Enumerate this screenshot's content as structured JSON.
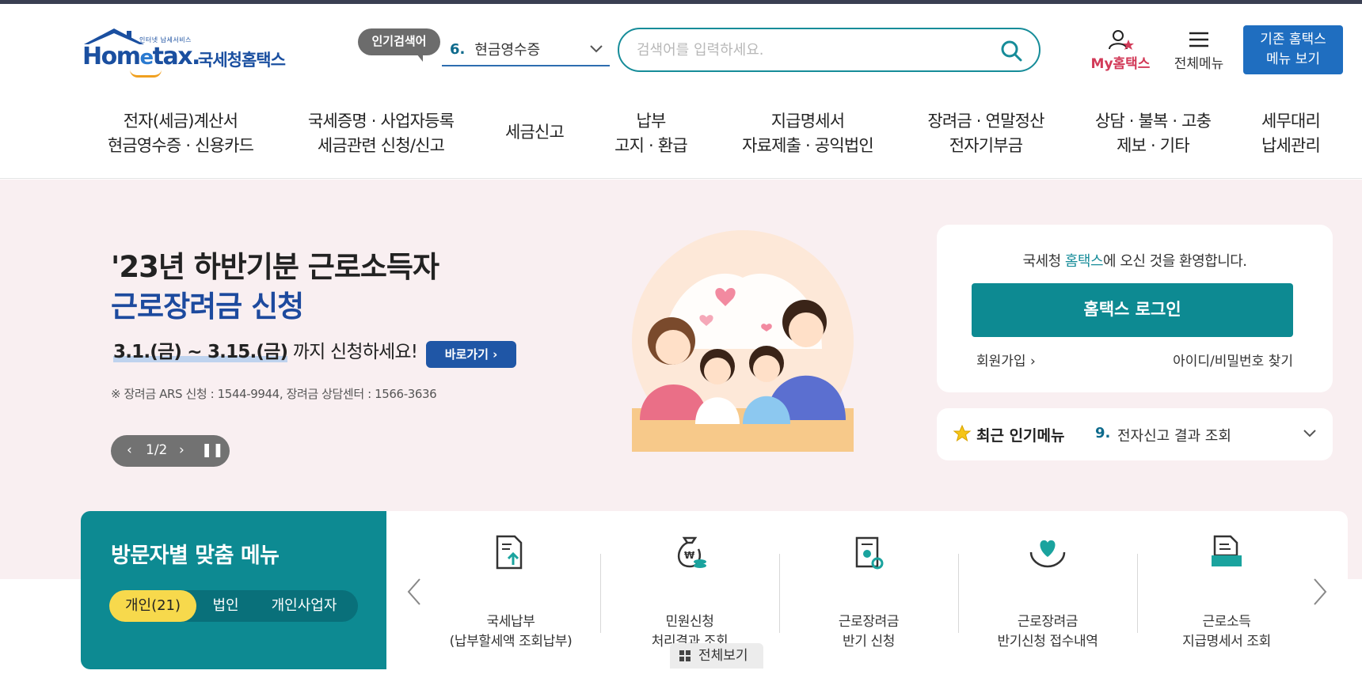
{
  "header": {
    "logo_sub": "인터넷 납세서비스",
    "logo_word_a": "Hom",
    "logo_word_e": "e",
    "logo_word_b": "tax.",
    "logo_kor": "국세청홈택스",
    "popular_badge": "인기검색어",
    "popular_num": "6.",
    "popular_text": "현금영수증",
    "search_placeholder": "검색어를 입력하세요.",
    "my_hometax": "My홈택스",
    "all_menu": "전체메뉴",
    "old_hometax_line1": "기존 홈택스",
    "old_hometax_line2": "메뉴 보기"
  },
  "nav": [
    {
      "line1": "전자(세금)계산서",
      "line2": "현금영수증 · 신용카드"
    },
    {
      "line1": "국세증명 · 사업자등록",
      "line2": "세금관련 신청/신고"
    },
    {
      "line1": "세금신고",
      "line2": ""
    },
    {
      "line1": "납부",
      "line2": "고지 · 환급"
    },
    {
      "line1": "지급명세서",
      "line2": "자료제출 · 공익법인"
    },
    {
      "line1": "장려금 · 연말정산",
      "line2": "전자기부금"
    },
    {
      "line1": "상담 · 불복 · 고충",
      "line2": "제보 · 기타"
    },
    {
      "line1": "세무대리",
      "line2": "납세관리"
    }
  ],
  "hero": {
    "title1": "'23년 하반기분 근로소득자",
    "title2": "근로장려금 신청",
    "date_range": "3.1.(금) ~ 3.15.(금)",
    "date_suffix": " 까지 신청하세요!",
    "go_button": "바로가기",
    "note": "※ 장려금 ARS 신청 : 1544-9944, 장려금 상담센터 : 1566-3636",
    "pager": "1/2"
  },
  "login_card": {
    "welcome_prefix": "국세청 ",
    "welcome_brand": "홈택스",
    "welcome_suffix": "에 오신 것을 환영합니다.",
    "login_button": "홈택스 로그인",
    "join": "회원가입",
    "find": "아이디/비밀번호 찾기"
  },
  "recent": {
    "title": "최근 인기메뉴",
    "num": "9.",
    "text": "전자신고 결과 조회"
  },
  "visitor": {
    "title": "방문자별 맞춤 메뉴",
    "tabs": [
      "개인(21)",
      "법인",
      "개인사업자"
    ],
    "services": [
      {
        "icon": "tax-payment-icon",
        "line1": "국세납부",
        "line2": "(납부할세액 조회납부)"
      },
      {
        "icon": "money-bag-icon",
        "line1": "민원신청",
        "line2": "처리결과 조회"
      },
      {
        "icon": "certificate-icon",
        "line1": "근로장려금",
        "line2": "반기 신청"
      },
      {
        "icon": "heart-hands-icon",
        "line1": "근로장려금",
        "line2": "반기신청 접수내역"
      },
      {
        "icon": "document-icon",
        "line1": "근로소득",
        "line2": "지급명세서 조회"
      }
    ],
    "view_all": "전체보기"
  },
  "colors": {
    "teal": "#0d8a92",
    "brand_blue": "#1f6ec0",
    "hero_bg": "#f9eff1",
    "pink": "#d23a58",
    "yellow": "#f7d94c"
  }
}
